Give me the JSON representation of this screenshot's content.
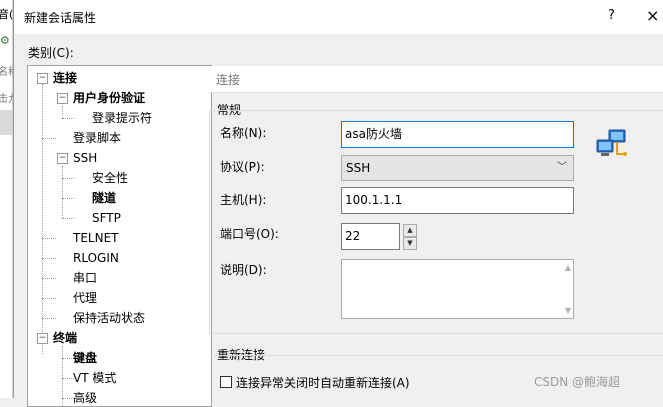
{
  "background_app": {
    "title_fragment": "音(\\",
    "text_a": "名称",
    "text_b": "击九"
  },
  "dialog": {
    "title": "新建会话属性",
    "help_label": "?",
    "close_label": "×"
  },
  "category_label": "类别(C):",
  "tree": [
    {
      "label": "连接",
      "bold": true,
      "expander": "-"
    },
    {
      "label": "用户身份验证",
      "bold": true,
      "expander": "-"
    },
    {
      "label": "登录提示符",
      "bold": false
    },
    {
      "label": "登录脚本",
      "bold": false
    },
    {
      "label": "SSH",
      "bold": false,
      "expander": "-"
    },
    {
      "label": "安全性",
      "bold": false
    },
    {
      "label": "隧道",
      "bold": true
    },
    {
      "label": "SFTP",
      "bold": false
    },
    {
      "label": "TELNET",
      "bold": false
    },
    {
      "label": "RLOGIN",
      "bold": false
    },
    {
      "label": "串口",
      "bold": false
    },
    {
      "label": "代理",
      "bold": false
    },
    {
      "label": "保持活动状态",
      "bold": false
    },
    {
      "label": "终端",
      "bold": true,
      "expander": "-"
    },
    {
      "label": "键盘",
      "bold": true
    },
    {
      "label": "VT 模式",
      "bold": false
    },
    {
      "label": "高级",
      "bold": false
    }
  ],
  "panel": {
    "header": "连接",
    "general_group": "常规",
    "name_label": "名称(N):",
    "name_value": "asa防火墙",
    "protocol_label": "协议(P):",
    "protocol_value": "SSH",
    "host_label": "主机(H):",
    "host_value": "100.1.1.1",
    "port_label": "端口号(O):",
    "port_value": "22",
    "desc_label": "说明(D):",
    "desc_value": "",
    "reconnect_group": "重新连接",
    "reconnect_checkbox_label": "连接异常关闭时自动重新连接(A)",
    "reconnect_checked": false
  },
  "watermark": "CSDN @鲍海超",
  "icons": {
    "computer": "network-computer-icon",
    "chevron": "chevron-down-icon"
  }
}
